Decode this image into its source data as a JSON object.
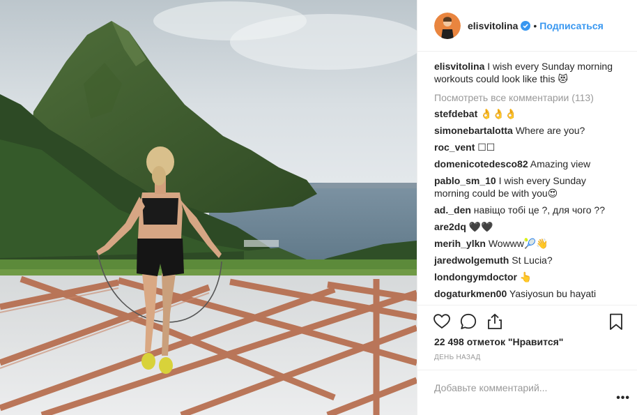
{
  "post": {
    "photo_alt": "",
    "header": {
      "username": "elisvitolina",
      "dot": "•",
      "follow_label": "Подписаться"
    },
    "caption": {
      "username": "elisvitolina",
      "text": "I wish every Sunday morning workouts could look like this 😻"
    },
    "view_all_label": "Посмотреть все комментарии (113)",
    "comments": [
      {
        "username": "stefdebat",
        "text": "👌👌👌"
      },
      {
        "username": "simonebartalotta",
        "text": "Where are you?"
      },
      {
        "username": "roc_vent",
        "text": "☐☐"
      },
      {
        "username": "domenicotedesco82",
        "text": "Amazing view"
      },
      {
        "username": "pablo_sm_10",
        "text": "I wish every Sunday morning could be with you😍"
      },
      {
        "username": "ad._den",
        "text": "навіщо тобі це ?, для чого ??"
      },
      {
        "username": "are2dq",
        "text": "🖤🖤"
      },
      {
        "username": "merih_ylkn",
        "text": "Wowww🎾👋"
      },
      {
        "username": "jaredwolgemuth",
        "text": "St Lucia?"
      },
      {
        "username": "londongymdoctor",
        "text": "👆"
      },
      {
        "username": "dogaturkmen00",
        "text": "Yasiyosun bu hayati"
      }
    ],
    "actions": {
      "like_icon": "heart-icon",
      "comment_icon": "comment-icon",
      "share_icon": "share-icon",
      "save_icon": "bookmark-icon"
    },
    "likes_label": "22 498 отметок \"Нравится\"",
    "time_label": "ДЕНЬ НАЗАД",
    "add_comment_placeholder": "Добавьте комментарий...",
    "more_label": "•••",
    "colors": {
      "link": "#3897f0",
      "muted": "#999999",
      "text": "#262626",
      "border": "#efefef"
    }
  }
}
